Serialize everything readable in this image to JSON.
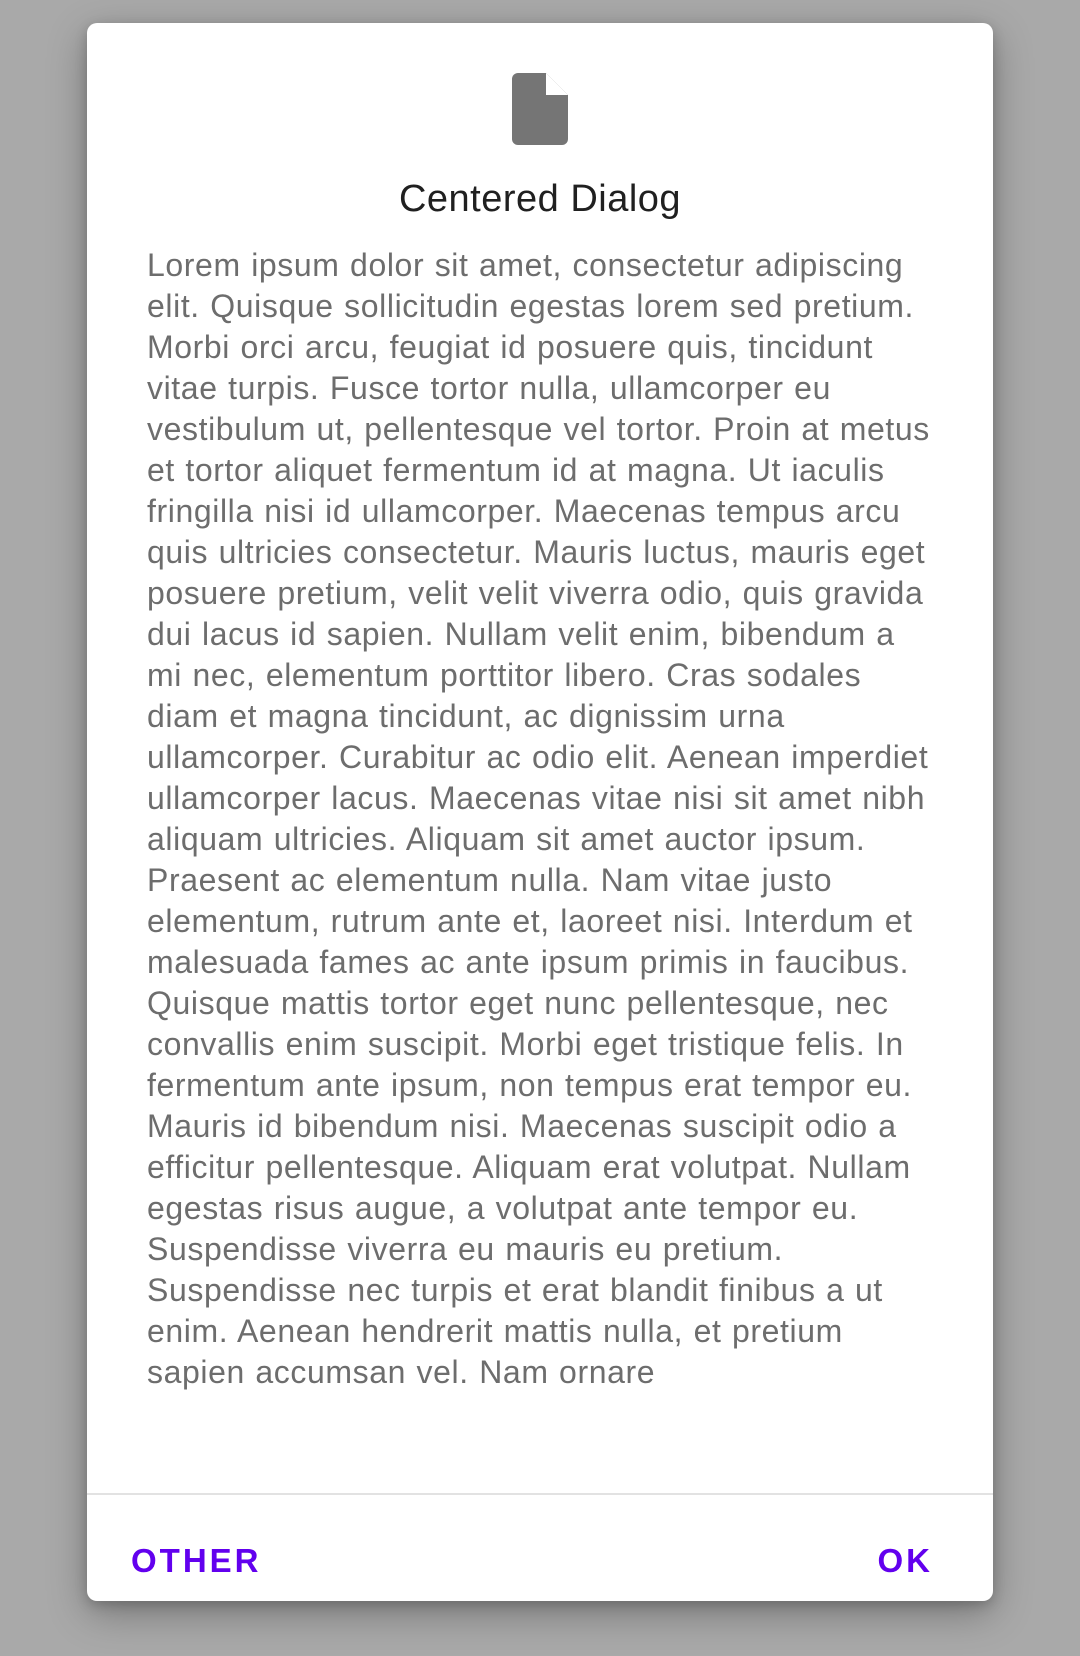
{
  "dialog": {
    "icon": "file-icon",
    "title": "Centered Dialog",
    "body": "Lorem ipsum dolor sit amet, consectetur adipiscing elit. Quisque sollicitudin egestas lorem sed pretium. Morbi orci arcu, feugiat id posuere quis, tincidunt vitae turpis. Fusce tortor nulla, ullamcorper eu vestibulum ut, pellentesque vel tortor. Proin at metus et tortor aliquet fermentum id at magna. Ut iaculis fringilla nisi id ullamcorper. Maecenas tempus arcu quis ultricies consectetur. Mauris luctus, mauris eget posuere pretium, velit velit viverra odio, quis gravida dui lacus id sapien. Nullam velit enim, bibendum a mi nec, elementum porttitor libero. Cras sodales diam et magna tincidunt, ac dignissim urna ullamcorper. Curabitur ac odio elit. Aenean imperdiet ullamcorper lacus. Maecenas vitae nisi sit amet nibh aliquam ultricies. Aliquam sit amet auctor ipsum. Praesent ac elementum nulla. Nam vitae justo elementum, rutrum ante et, laoreet nisi. Interdum et malesuada fames ac ante ipsum primis in faucibus. Quisque mattis tortor eget nunc pellentesque, nec convallis enim suscipit. Morbi eget tristique felis. In fermentum ante ipsum, non tempus erat tempor eu. Mauris id bibendum nisi. Maecenas suscipit odio a efficitur pellentesque. Aliquam erat volutpat. Nullam egestas risus augue, a volutpat ante tempor eu. Suspendisse viverra eu mauris eu pretium. Suspendisse nec turpis et erat blandit finibus a ut enim. Aenean hendrerit mattis nulla, et pretium sapien accumsan vel. Nam ornare",
    "buttons": {
      "other": "OTHER",
      "ok": "OK"
    }
  },
  "colors": {
    "scrim": "#a9a9a9",
    "surface": "#ffffff",
    "accent": "#6200ee",
    "title": "#202020",
    "body": "#6d6d6d",
    "icon": "#757575"
  }
}
